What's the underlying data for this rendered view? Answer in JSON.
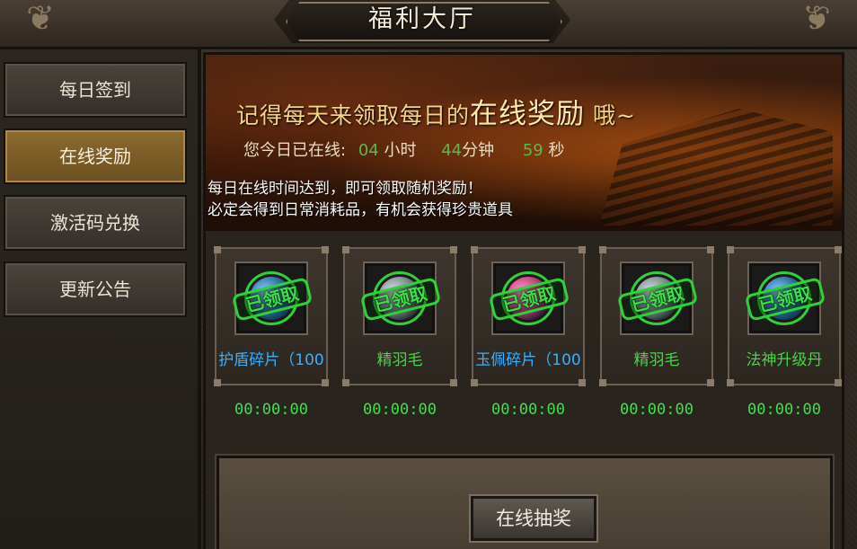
{
  "window": {
    "title": "福利大厅"
  },
  "sidebar": {
    "items": [
      {
        "label": "每日签到",
        "active": false
      },
      {
        "label": "在线奖励",
        "active": true
      },
      {
        "label": "激活码兑换",
        "active": false
      },
      {
        "label": "更新公告",
        "active": false
      }
    ]
  },
  "banner": {
    "headline_pre": "记得每天来领取每日的",
    "headline_big": "在线奖励",
    "headline_post": "哦~",
    "online_label": "您今日已在线:",
    "hours_value": "04",
    "hours_unit": "小时",
    "minutes_value": "44",
    "minutes_unit": "分钟",
    "seconds_value": "59",
    "seconds_unit": "秒",
    "desc_line1": "每日在线时间达到，即可领取随机奖励！",
    "desc_line2": "必定会得到日常消耗品，有机会获得珍贵道具"
  },
  "rewards": [
    {
      "name": "护盾碎片（100",
      "name_color": "#3ab0ff",
      "stamp": "已领取",
      "timer": "00:00:00",
      "icon": "shield-shard-icon"
    },
    {
      "name": "精羽毛",
      "name_color": "#46d646",
      "stamp": "已领取",
      "timer": "00:00:00",
      "icon": "feather-icon"
    },
    {
      "name": "玉佩碎片（100",
      "name_color": "#3ab0ff",
      "stamp": "已领取",
      "timer": "00:00:00",
      "icon": "jade-shard-icon"
    },
    {
      "name": "精羽毛",
      "name_color": "#46d646",
      "stamp": "已领取",
      "timer": "00:00:00",
      "icon": "feather-icon"
    },
    {
      "name": "法神升级丹",
      "name_color": "#46d646",
      "stamp": "已领取",
      "timer": "00:00:00",
      "icon": "upgrade-pill-icon"
    }
  ],
  "lottery": {
    "button_label": "在线抽奖"
  }
}
